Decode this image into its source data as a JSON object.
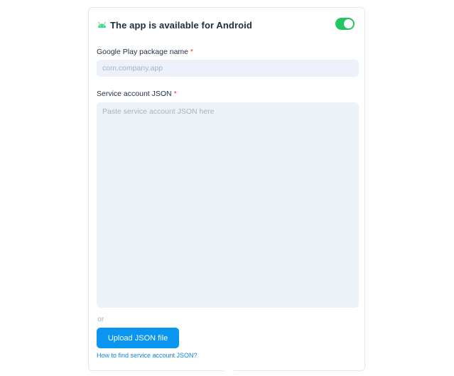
{
  "header": {
    "icon": "android-icon",
    "title": "The app is available for Android",
    "toggle_on": true,
    "accent_color": "#22c55e"
  },
  "package_field": {
    "label": "Google Play package name",
    "required_mark": "*",
    "value": "",
    "placeholder": "com.company.app"
  },
  "service_account_field": {
    "label": "Service account JSON",
    "required_mark": "*",
    "value": "",
    "placeholder": "Paste service account JSON here"
  },
  "separator_text": "or",
  "upload_button": {
    "label": "Upload JSON file",
    "color": "#0a95f0"
  },
  "help_link": {
    "label": "How to find service account JSON?"
  }
}
